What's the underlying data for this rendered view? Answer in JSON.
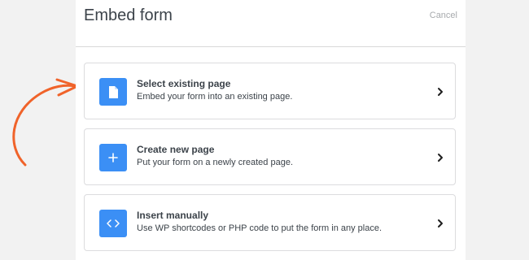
{
  "header": {
    "title": "Embed form",
    "cancel_label": "Cancel"
  },
  "options": [
    {
      "title": "Select existing page",
      "description": "Embed your form into an existing page.",
      "icon": "page-icon"
    },
    {
      "title": "Create new page",
      "description": "Put your form on a newly created page.",
      "icon": "plus-icon"
    },
    {
      "title": "Insert manually",
      "description": "Use WP shortcodes or PHP code to put the form in any place.",
      "icon": "code-icon"
    }
  ],
  "colors": {
    "accent_blue": "#3b8ff5",
    "arrow_orange": "#f0632a"
  }
}
